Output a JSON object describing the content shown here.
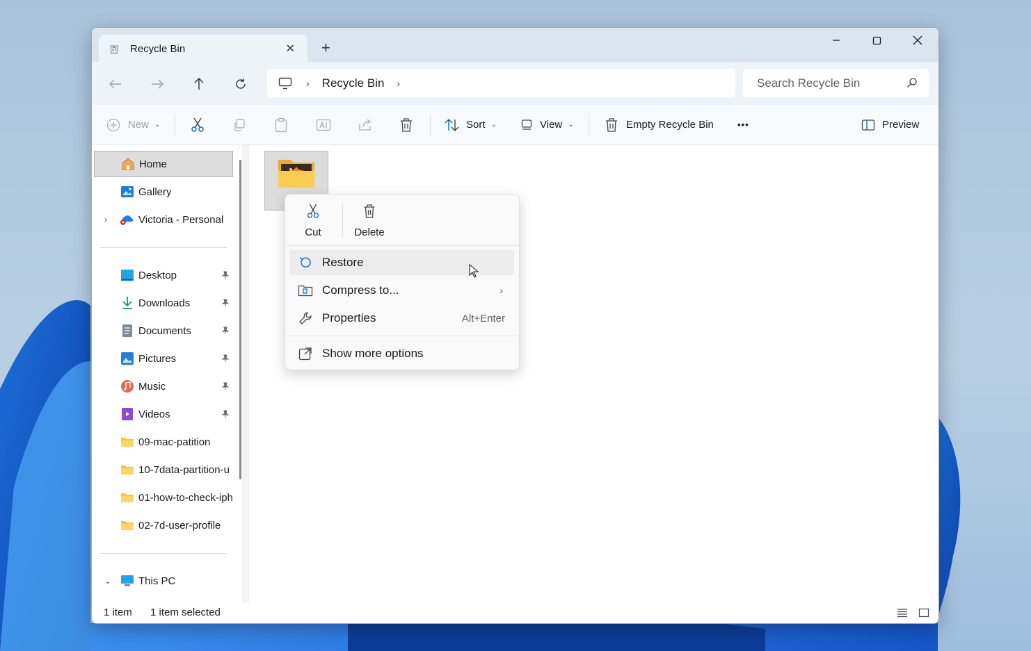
{
  "window": {
    "tab_title": "Recycle Bin",
    "new_tab_label": "+",
    "close_tab_label": "✕"
  },
  "nav": {
    "breadcrumb": [
      "Recycle Bin"
    ],
    "search_placeholder": "Search Recycle Bin"
  },
  "toolbar": {
    "new_label": "New",
    "sort_label": "Sort",
    "view_label": "View",
    "empty_label": "Empty Recycle Bin",
    "more_label": "•••",
    "preview_label": "Preview"
  },
  "sidebar": {
    "home": "Home",
    "gallery": "Gallery",
    "onedrive": "Victoria - Personal",
    "desktop": "Desktop",
    "downloads": "Downloads",
    "documents": "Documents",
    "pictures": "Pictures",
    "music": "Music",
    "videos": "Videos",
    "folder1": "09-mac-patition",
    "folder2": "10-7data-partition-u",
    "folder3": "01-how-to-check-iph",
    "folder4": "02-7d-user-profile",
    "this_pc": "This PC"
  },
  "status": {
    "count": "1 item",
    "selected": "1 item selected"
  },
  "context_menu": {
    "cut": "Cut",
    "delete": "Delete",
    "restore": "Restore",
    "compress": "Compress to...",
    "properties": "Properties",
    "properties_shortcut": "Alt+Enter",
    "more_options": "Show more options"
  },
  "colors": {
    "accent": "#0067c0",
    "folder_yellow": "#f8c43a",
    "onedrive_blue": "#0a84ff",
    "error_red": "#c42b1c"
  }
}
